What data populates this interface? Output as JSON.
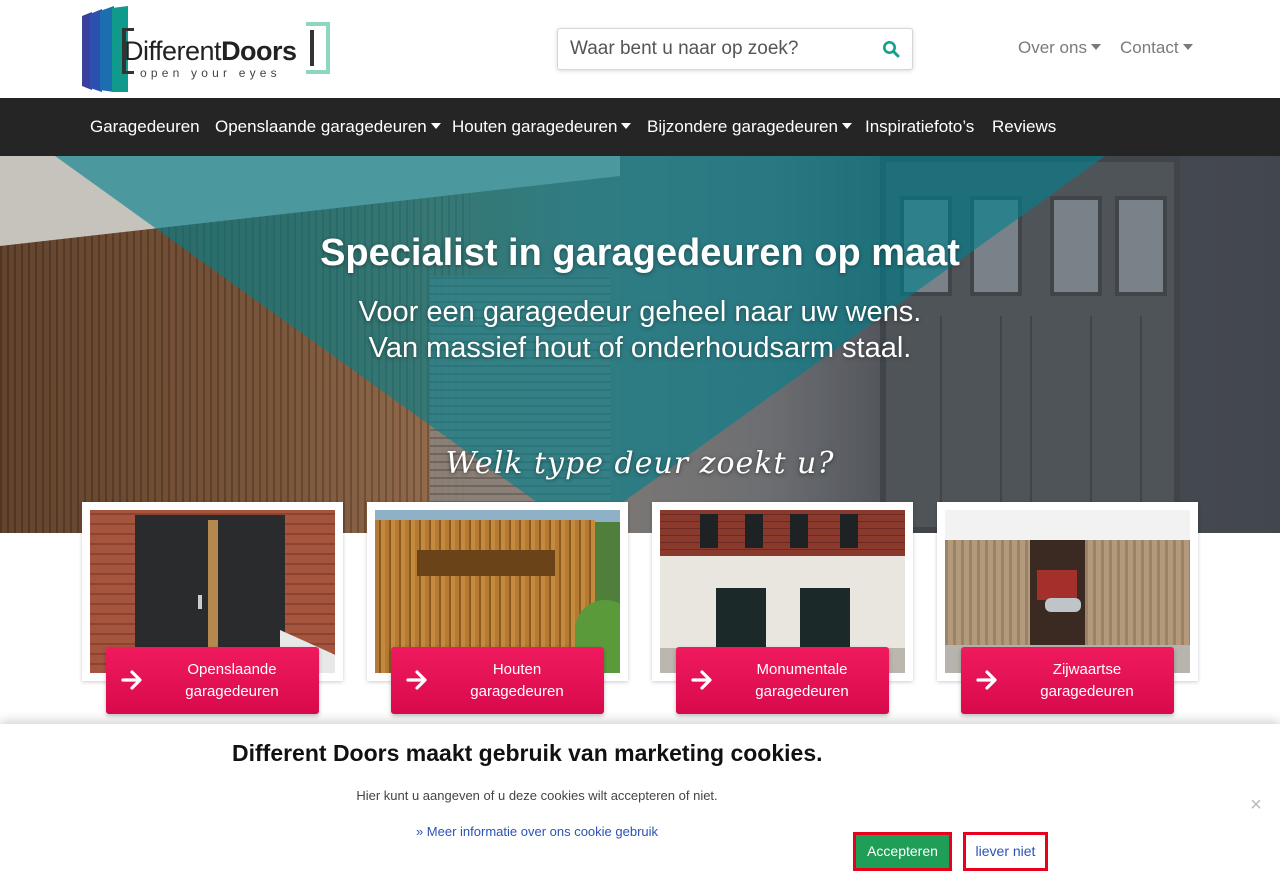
{
  "logo": {
    "word_regular": "Different",
    "word_bold": "Doors",
    "tagline": "open your eyes"
  },
  "search": {
    "placeholder": "Waar bent u naar op zoek?"
  },
  "topnav": {
    "about": "Over ons",
    "contact": "Contact"
  },
  "mainnav": {
    "items": [
      {
        "label": "Garagedeuren"
      },
      {
        "label": "Openslaande garagedeuren"
      },
      {
        "label": "Houten garagedeuren"
      },
      {
        "label": "Bijzondere garagedeuren"
      },
      {
        "label": "Inspiratiefoto’s"
      },
      {
        "label": "Reviews"
      }
    ]
  },
  "hero": {
    "title": "Specialist in garagedeuren op maat",
    "sub1": "Voor een garagedeur geheel naar uw wens.",
    "sub2": "Van massief hout of onderhoudsarm staal.",
    "question": "Welk type deur zoekt u?"
  },
  "cards": [
    {
      "line1": "Openslaande",
      "line2": "garagedeuren"
    },
    {
      "line1": "Houten",
      "line2": "garagedeuren"
    },
    {
      "line1": "Monumentale",
      "line2": "garagedeuren"
    },
    {
      "line1": "Zijwaartse",
      "line2": "garagedeuren"
    }
  ],
  "cookie": {
    "title": "Different Doors maakt gebruik van marketing cookies.",
    "text": "Hier kunt u aangeven of u deze cookies wilt accepteren of niet.",
    "link": "» Meer informatie over ons cookie gebruik",
    "accept": "Accepteren",
    "decline": "liever niet",
    "close": "×"
  },
  "colors": {
    "nav_bg": "#252525",
    "accent_pink": "#e8105a",
    "teal": "#00808c",
    "accept_green": "#1e9e57",
    "outline_red": "#e8001c"
  }
}
